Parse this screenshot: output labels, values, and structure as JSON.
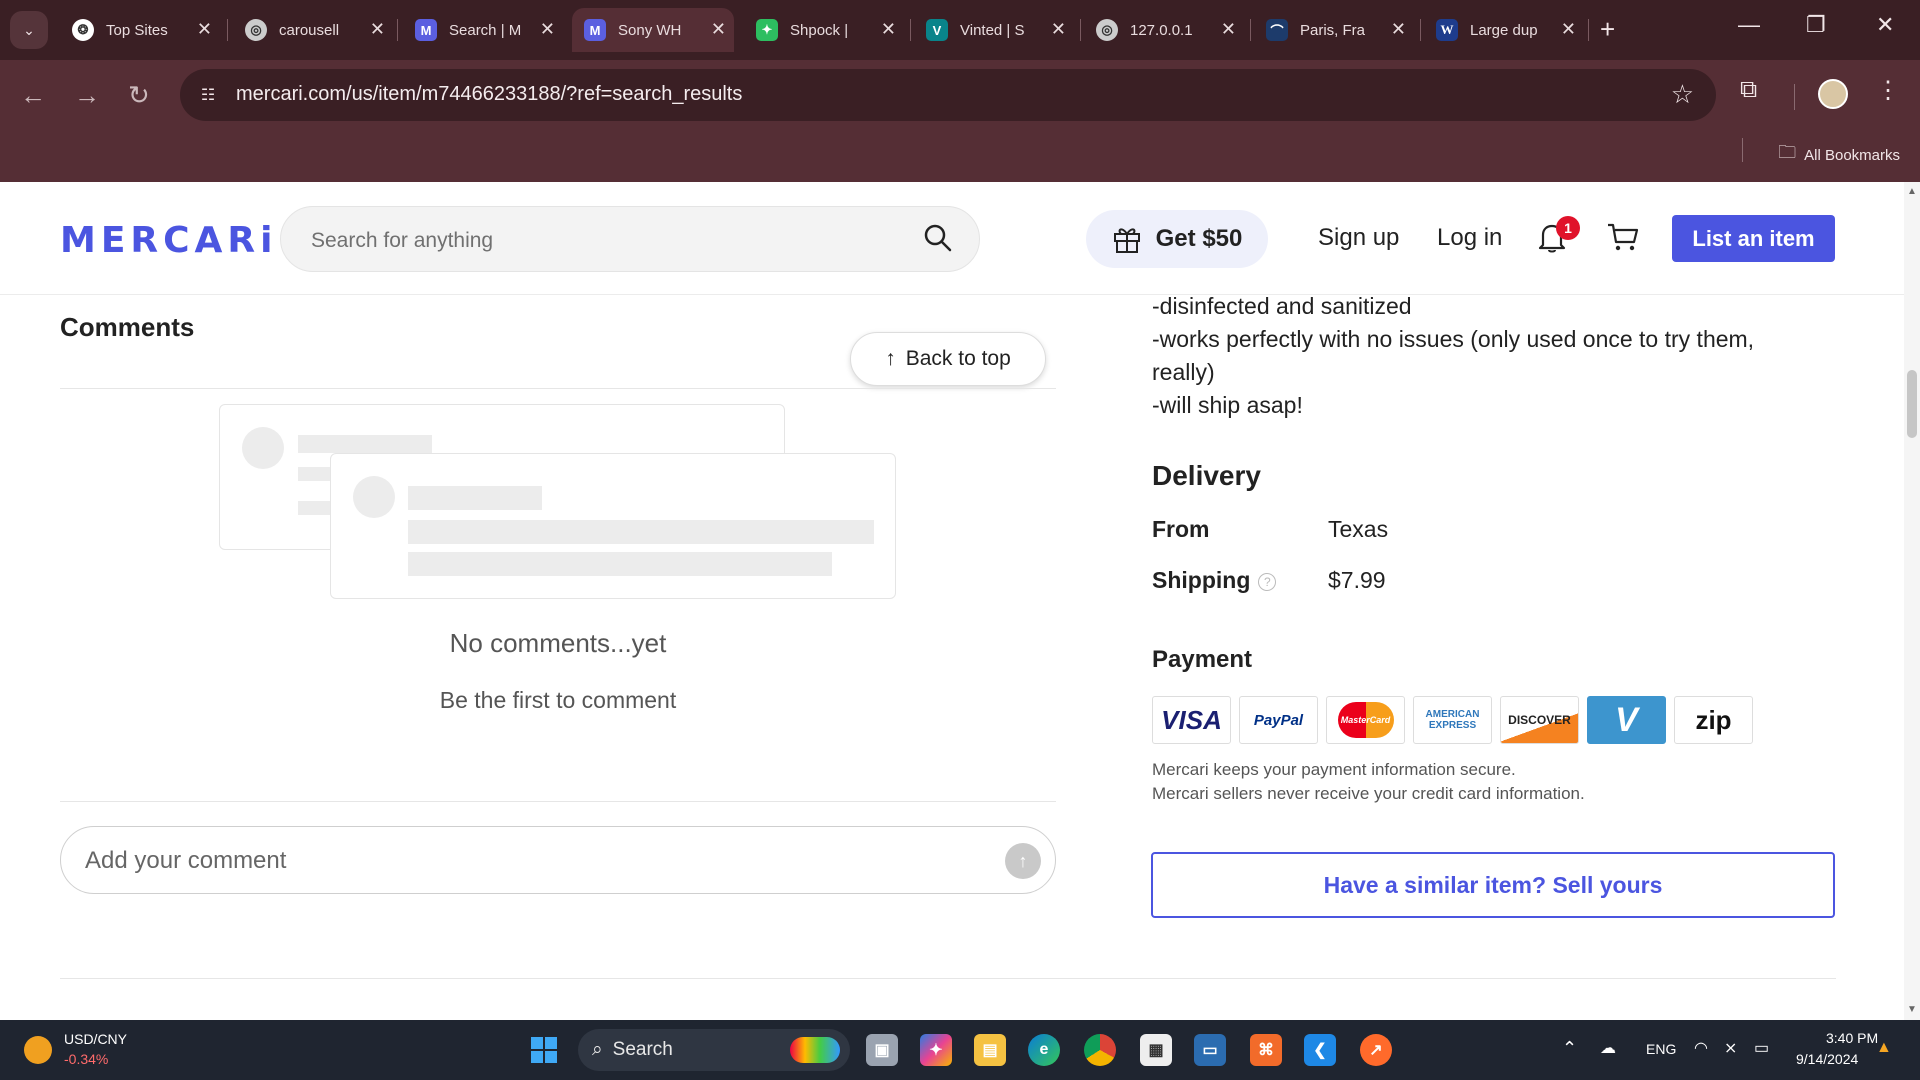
{
  "browser": {
    "tabs": [
      {
        "title": "Top Sites",
        "icon": "openai-icon"
      },
      {
        "title": "carousell",
        "icon": "globe-icon"
      },
      {
        "title": "Search | M",
        "icon": "mercari-icon"
      },
      {
        "title": "Sony WH",
        "icon": "mercari-icon",
        "active": true
      },
      {
        "title": "Shpock |",
        "icon": "shpock-icon"
      },
      {
        "title": "Vinted | S",
        "icon": "vinted-icon"
      },
      {
        "title": "127.0.0.1",
        "icon": "globe-icon"
      },
      {
        "title": "Paris, Fra",
        "icon": "paris-icon"
      },
      {
        "title": "Large dup",
        "icon": "wordpress-icon"
      }
    ],
    "url": "mercari.com/us/item/m74466233188/?ref=search_results",
    "bookmarks_label": "All Bookmarks"
  },
  "header": {
    "logo": "MERCARi",
    "search_placeholder": "Search for anything",
    "promo_label": "Get $50",
    "signup_label": "Sign up",
    "login_label": "Log in",
    "notification_count": "1",
    "list_button": "List an item"
  },
  "comments": {
    "title": "Comments",
    "back_to_top": "Back to top",
    "empty_title": "No comments...yet",
    "empty_subtitle": "Be the first to comment",
    "input_placeholder": "Add your comment"
  },
  "description": {
    "lines": [
      "-disinfected and sanitized",
      "-works perfectly with no issues (only used once to try them,",
      "really)",
      "-will ship asap!"
    ]
  },
  "delivery": {
    "title": "Delivery",
    "from_label": "From",
    "from_value": "Texas",
    "shipping_label": "Shipping",
    "shipping_value": "$7.99"
  },
  "payment": {
    "title": "Payment",
    "cards": [
      "VISA",
      "PayPal",
      "MasterCard",
      "AMERICAN EXPRESS",
      "DISCOVER",
      "V",
      "zip"
    ],
    "note_line1": "Mercari keeps your payment information secure.",
    "note_line2": "Mercari sellers never receive your credit card information.",
    "sell_button": "Have a similar item? Sell yours"
  },
  "taskbar": {
    "ticker_name": "USD/CNY",
    "ticker_change": "-0.34%",
    "search_label": "Search",
    "language": "ENG",
    "time": "3:40 PM",
    "date": "9/14/2024"
  },
  "colors": {
    "brand": "#4b55e0",
    "chrome_dark": "#3a1f24",
    "chrome_toolbar": "#552e35",
    "badge": "#e0122a"
  }
}
